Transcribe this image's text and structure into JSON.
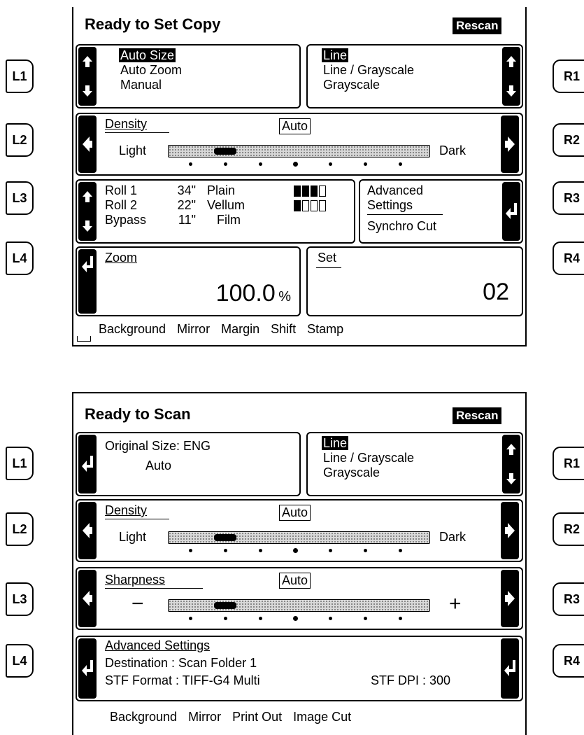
{
  "copy_screen": {
    "title": "Ready to Set Copy",
    "rescan": "Rescan",
    "left_keys": [
      "L1",
      "L2",
      "L3",
      "L4"
    ],
    "right_keys": [
      "R1",
      "R2",
      "R3",
      "R4"
    ],
    "size_options": [
      "Auto Size",
      "Auto Zoom",
      "Manual"
    ],
    "size_selected": "Auto Size",
    "mode_options": [
      "Line",
      "Line / Grayscale",
      "Grayscale"
    ],
    "mode_selected": "Line",
    "density": {
      "label": "Density",
      "auto": "Auto",
      "min_label": "Light",
      "max_label": "Dark",
      "level": 2,
      "steps": 7
    },
    "rolls": {
      "names": [
        "Roll 1",
        "Roll 2",
        "Bypass"
      ],
      "sizes": [
        "34\"",
        "22\"",
        "11\""
      ],
      "media": [
        "Plain",
        "Vellum",
        "Film"
      ],
      "levels": [
        3,
        1
      ],
      "meter_max": 4
    },
    "advanced": {
      "line1": "Advanced",
      "line2": "Settings",
      "sub": "Synchro Cut"
    },
    "zoom": {
      "label": "Zoom",
      "value": "100.0",
      "unit": "%"
    },
    "set": {
      "label": "Set",
      "value": "02"
    },
    "footer": [
      "Background",
      "Mirror",
      "Margin",
      "Shift",
      "Stamp"
    ]
  },
  "scan_screen": {
    "title": "Ready to Scan",
    "rescan": "Rescan",
    "left_keys": [
      "L1",
      "L2",
      "L3",
      "L4"
    ],
    "right_keys": [
      "R1",
      "R2",
      "R3",
      "R4"
    ],
    "original": {
      "label": "Original Size: ENG",
      "value": "Auto"
    },
    "mode_options": [
      "Line",
      "Line / Grayscale",
      "Grayscale"
    ],
    "mode_selected": "Line",
    "density": {
      "label": "Density",
      "auto": "Auto",
      "min_label": "Light",
      "max_label": "Dark",
      "level": 2,
      "steps": 7
    },
    "sharpness": {
      "label": "Sharpness",
      "auto": "Auto",
      "min_label": "−",
      "max_label": "+",
      "level": 2,
      "steps": 7
    },
    "advanced": {
      "title": "Advanced Settings",
      "destination": "Destination : Scan Folder 1",
      "format": "STF Format : TIFF-G4 Multi",
      "dpi": "STF DPI : 300"
    },
    "footer": [
      "Background",
      "Mirror",
      "Print Out",
      "Image Cut"
    ]
  }
}
